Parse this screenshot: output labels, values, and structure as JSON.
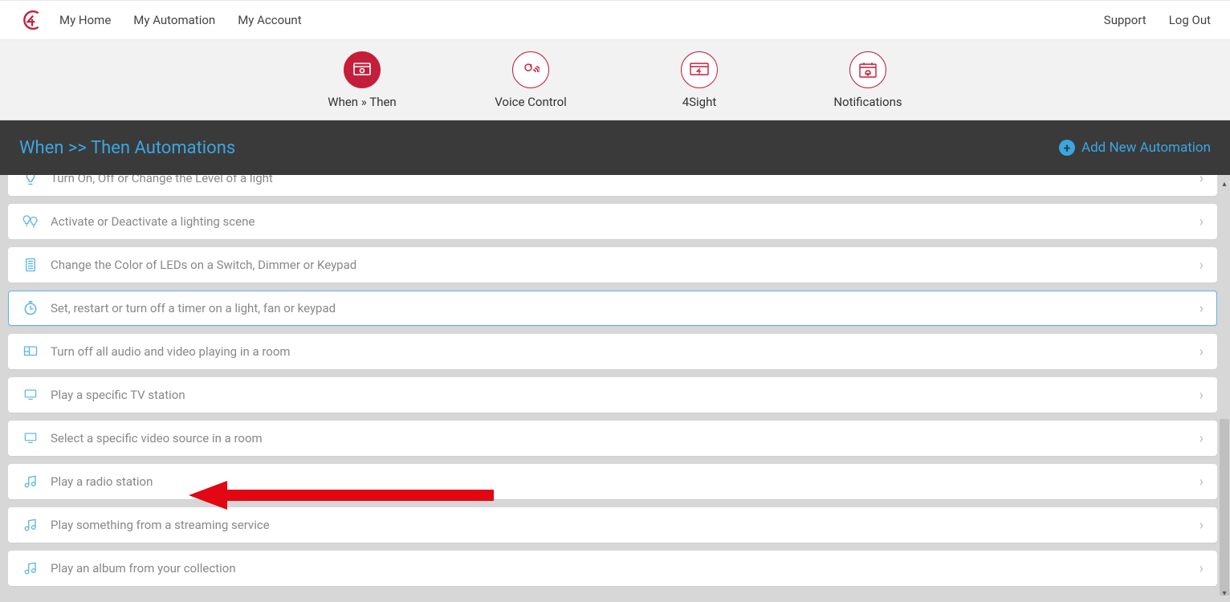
{
  "nav": {
    "left": [
      "My Home",
      "My Automation",
      "My Account"
    ],
    "right": [
      "Support",
      "Log Out"
    ]
  },
  "tabs": [
    {
      "id": "when-then",
      "label": "When » Then",
      "icon": "screen",
      "active": true
    },
    {
      "id": "voice",
      "label": "Voice Control",
      "icon": "voice",
      "active": false
    },
    {
      "id": "4sight",
      "label": "4Sight",
      "icon": "4sight",
      "active": false
    },
    {
      "id": "notifications",
      "label": "Notifications",
      "icon": "bell",
      "active": false
    }
  ],
  "header": {
    "title": "When >> Then Automations",
    "add_label": "Add New Automation"
  },
  "actions": [
    {
      "icon": "bulb",
      "label": "Turn On, Off or Change the Level of a light",
      "selected": false
    },
    {
      "icon": "bulbs",
      "label": "Activate or Deactivate a lighting scene",
      "selected": false
    },
    {
      "icon": "keypad",
      "label": "Change the Color of LEDs on a Switch, Dimmer or Keypad",
      "selected": false
    },
    {
      "icon": "timer",
      "label": "Set, restart or turn off a timer on a light, fan or keypad",
      "selected": true
    },
    {
      "icon": "room",
      "label": "Turn off all audio and video playing in a room",
      "selected": false
    },
    {
      "icon": "tv",
      "label": "Play a specific TV station",
      "selected": false
    },
    {
      "icon": "tv",
      "label": "Select a specific video source in a room",
      "selected": false
    },
    {
      "icon": "music",
      "label": "Play a radio station",
      "selected": false
    },
    {
      "icon": "music",
      "label": "Play something from a streaming service",
      "selected": false
    },
    {
      "icon": "music",
      "label": "Play an album from your collection",
      "selected": false
    }
  ]
}
